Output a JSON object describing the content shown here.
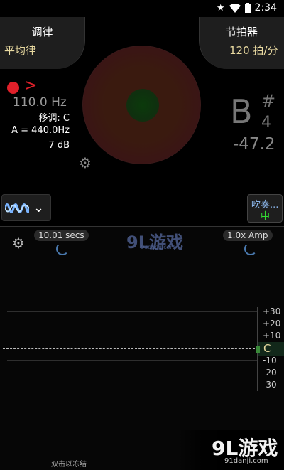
{
  "status_bar": {
    "time": "2:34"
  },
  "temperament_panel": {
    "title": "调律",
    "value": "平均律"
  },
  "metronome_panel": {
    "title": "节拍器",
    "value": "120 拍/分"
  },
  "left_info": {
    "frequency": "110.0 Hz",
    "transpose": "移调: C",
    "reference": "A = 440.0Hz",
    "db": "7 dB"
  },
  "note_display": {
    "note": "B",
    "accidental": "#",
    "octave": "4",
    "cents": "-47.2"
  },
  "play_button": {
    "label": "吹奏...",
    "mode": "中"
  },
  "graph": {
    "time_window": "10.01 secs",
    "amp": "1.0x Amp",
    "ticks": [
      "+30",
      "+20",
      "+10",
      "-10",
      "-20",
      "-30"
    ],
    "center_note": "C",
    "freeze_hint": "双击以冻结"
  },
  "watermark": {
    "logo": "9L游戏",
    "site": "91danji.com"
  },
  "colors": {
    "accent_red": "#e0202a",
    "accent_green": "#33dd33",
    "value_gold": "#e8d9a0"
  },
  "icons": [
    "star-icon",
    "wifi-icon",
    "battery-icon",
    "record-dot-icon",
    "arrow-icon",
    "gear-icon",
    "waveform-icon",
    "chevron-down-icon",
    "spinner-icon"
  ]
}
